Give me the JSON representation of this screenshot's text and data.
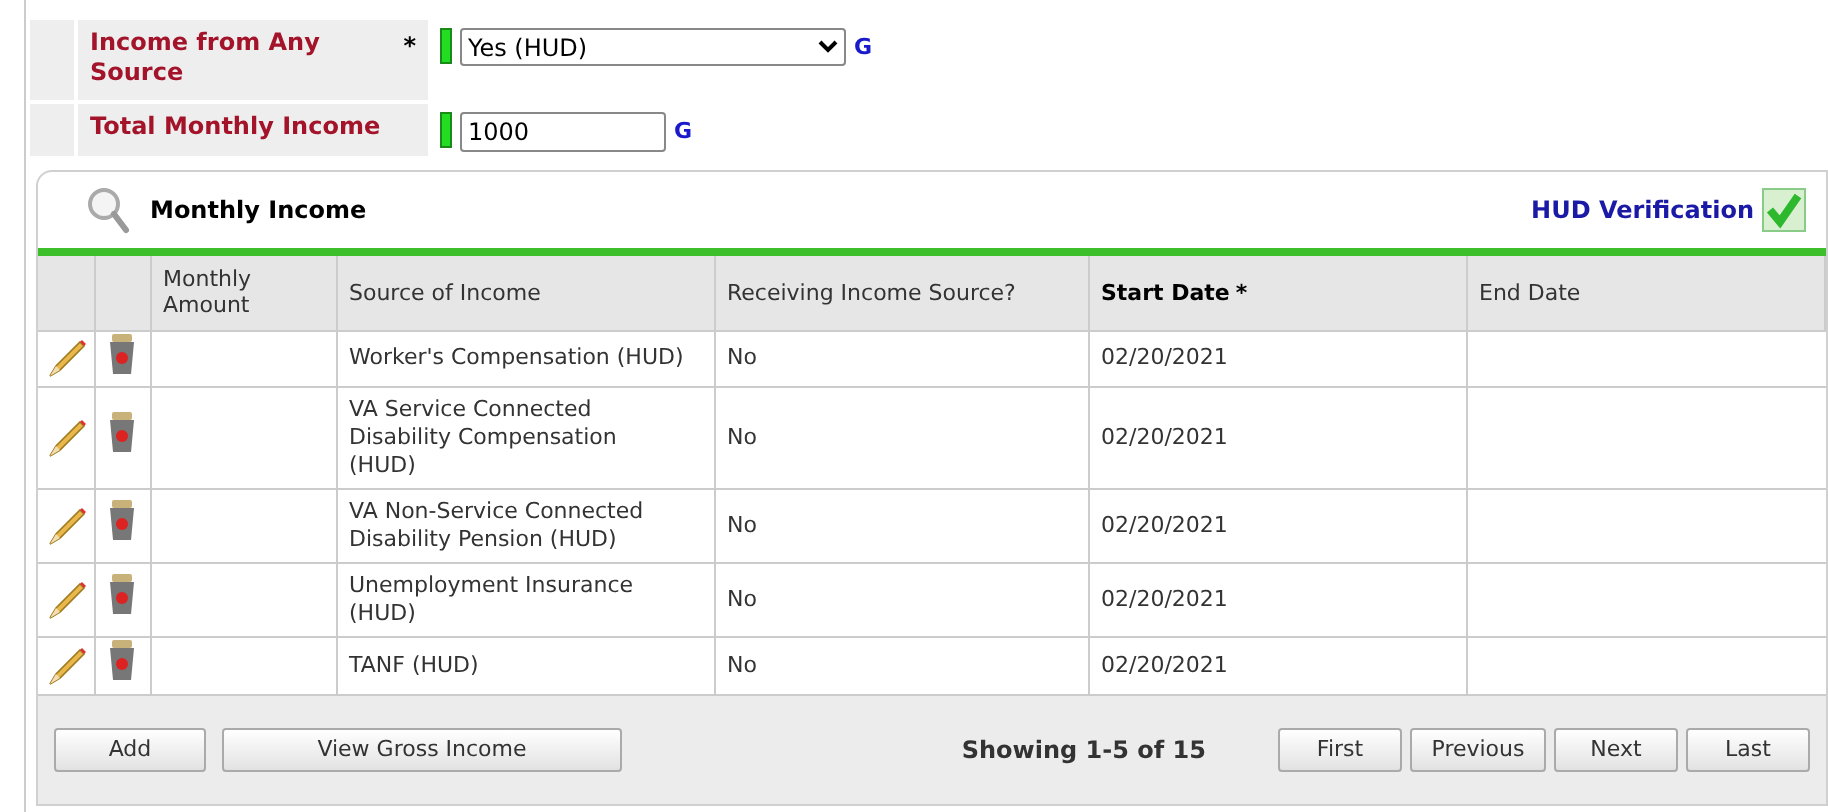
{
  "form": {
    "fields": [
      {
        "kind": "select",
        "label": "Income from Any Source",
        "required_mark": "*",
        "value": "Yes (HUD)",
        "link": "G"
      },
      {
        "kind": "input",
        "label": "Total Monthly Income",
        "value": "1000",
        "link": "G"
      }
    ]
  },
  "panel": {
    "title": "Monthly Income",
    "verification": "HUD Verification",
    "verified": true,
    "columns": [
      {
        "label": "Monthly Amount",
        "bold": false
      },
      {
        "label": "Source of Income",
        "bold": false
      },
      {
        "label": "Receiving Income Source?",
        "bold": false
      },
      {
        "label": "Start Date",
        "bold": true,
        "required_mark": "*"
      },
      {
        "label": "End Date",
        "bold": false
      }
    ],
    "rows": [
      {
        "source": "Worker's Compensation (HUD)",
        "receiving": "No",
        "start_date": "02/20/2021"
      },
      {
        "source": "VA Service Connected Disability Compensation (HUD)",
        "receiving": "No",
        "start_date": "02/20/2021"
      },
      {
        "source": "VA Non-Service Connected Disability Pension (HUD)",
        "receiving": "No",
        "start_date": "02/20/2021"
      },
      {
        "source": "Unemployment Insurance (HUD)",
        "receiving": "No",
        "start_date": "02/20/2021"
      },
      {
        "source": "TANF (HUD)",
        "receiving": "No",
        "start_date": "02/20/2021"
      }
    ],
    "footer": {
      "buttons": [
        "Add",
        "View Gross Income"
      ],
      "showing": "Showing 1-5 of 15",
      "pager": [
        "First",
        "Previous",
        "Next",
        "Last"
      ]
    }
  }
}
